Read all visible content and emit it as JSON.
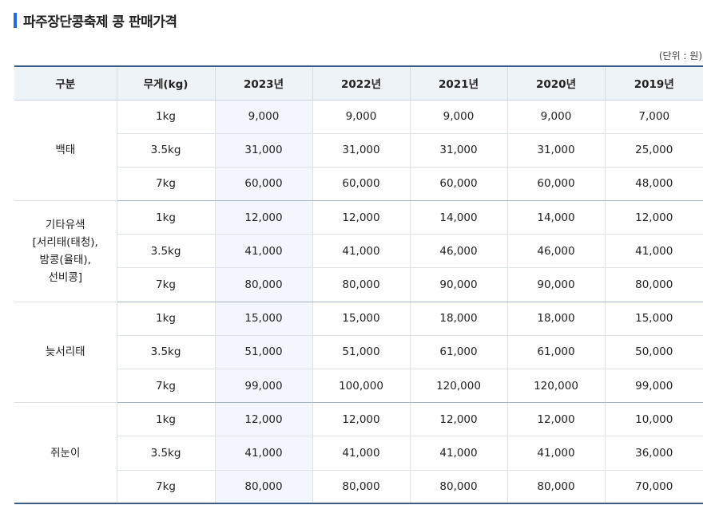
{
  "title": "파주장단콩축제 콩 판매가격",
  "unit_note": "(단위 : 원)",
  "headers": [
    "구분",
    "무게(kg)",
    "2023년",
    "2022년",
    "2021년",
    "2020년",
    "2019년"
  ],
  "groups": [
    {
      "category": "백태",
      "rows": [
        {
          "weight": "1kg",
          "prices": [
            "9,000",
            "9,000",
            "9,000",
            "9,000",
            "7,000"
          ]
        },
        {
          "weight": "3.5kg",
          "prices": [
            "31,000",
            "31,000",
            "31,000",
            "31,000",
            "25,000"
          ]
        },
        {
          "weight": "7kg",
          "prices": [
            "60,000",
            "60,000",
            "60,000",
            "60,000",
            "48,000"
          ]
        }
      ]
    },
    {
      "category_lines": [
        "기타유색",
        "[서리태(태청),",
        "밤콩(율태),",
        "선비콩]"
      ],
      "rows": [
        {
          "weight": "1kg",
          "prices": [
            "12,000",
            "12,000",
            "14,000",
            "14,000",
            "12,000"
          ]
        },
        {
          "weight": "3.5kg",
          "prices": [
            "41,000",
            "41,000",
            "46,000",
            "46,000",
            "41,000"
          ]
        },
        {
          "weight": "7kg",
          "prices": [
            "80,000",
            "80,000",
            "90,000",
            "90,000",
            "80,000"
          ]
        }
      ]
    },
    {
      "category": "늦서리태",
      "rows": [
        {
          "weight": "1kg",
          "prices": [
            "15,000",
            "15,000",
            "18,000",
            "18,000",
            "15,000"
          ]
        },
        {
          "weight": "3.5kg",
          "prices": [
            "51,000",
            "51,000",
            "61,000",
            "61,000",
            "50,000"
          ]
        },
        {
          "weight": "7kg",
          "prices": [
            "99,000",
            "100,000",
            "120,000",
            "120,000",
            "99,000"
          ]
        }
      ]
    },
    {
      "category": "쥐눈이",
      "rows": [
        {
          "weight": "1kg",
          "prices": [
            "12,000",
            "12,000",
            "12,000",
            "12,000",
            "10,000"
          ]
        },
        {
          "weight": "3.5kg",
          "prices": [
            "41,000",
            "41,000",
            "41,000",
            "41,000",
            "36,000"
          ]
        },
        {
          "weight": "7kg",
          "prices": [
            "80,000",
            "80,000",
            "80,000",
            "80,000",
            "70,000"
          ]
        }
      ]
    }
  ],
  "colors": {
    "accent": "#1f6fd8",
    "header_bg": "#eef3f8",
    "highlight_col_bg": "#f3f7fd",
    "table_border": "#3a5a88"
  }
}
